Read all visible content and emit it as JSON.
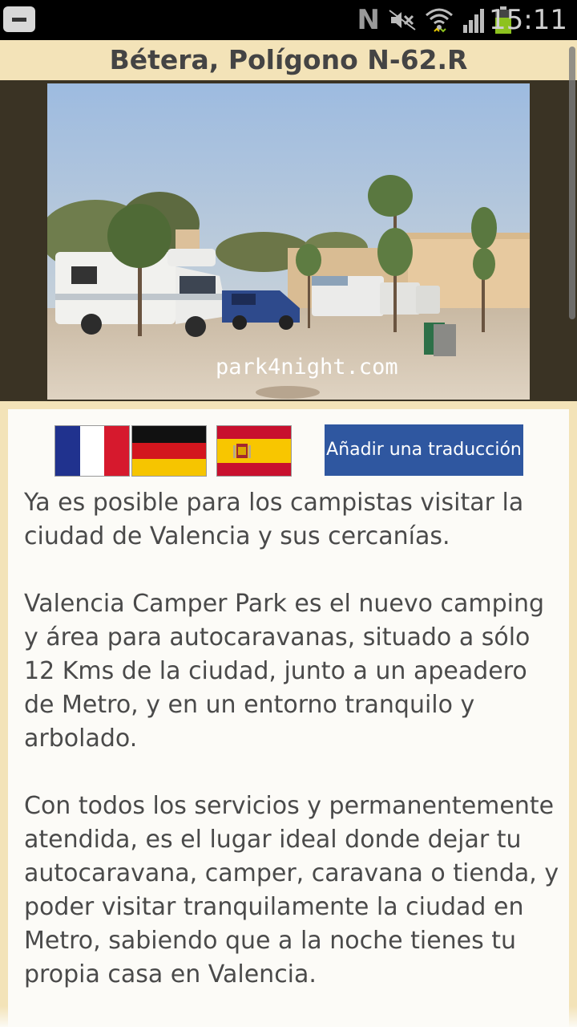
{
  "status_bar": {
    "time": "15:11",
    "network_letter": "N",
    "icons": [
      "back-icon",
      "nfc-icon",
      "mute-icon",
      "wifi-icon",
      "signal-icon",
      "battery-icon"
    ],
    "battery_color": "#8dc21f"
  },
  "header": {
    "title": "Bétera,  Polígono N-62.R"
  },
  "photo": {
    "watermark": "park4night.com"
  },
  "languages": {
    "flags": [
      "french-flag",
      "german-flag",
      "spanish-flag"
    ],
    "translate_button": "Añadir una traducción",
    "button_color": "#2f57a0"
  },
  "description": {
    "paragraphs": [
      "Ya es posible para los campistas visitar la ciudad de Valencia y sus cercanías.",
      "Valencia Camper Park es el nuevo camping y área para autocaravanas, situado a sólo 12 Kms de la ciudad, junto a un apeadero de Metro, y en un entorno tranquilo y arbolado.",
      "Con todos los servicios y permanentemente atendida, es el lugar ideal donde dejar tu autocaravana, camper, caravana o tienda, y poder visitar tranquilamente la ciudad en Metro, sabiendo que a la noche tienes tu propia casa en Valencia."
    ]
  },
  "colors": {
    "page_background": "#f3e3b8",
    "card_background": "#fcfbf7",
    "photo_frame": "#3a3324",
    "text": "#4a4a4a"
  }
}
